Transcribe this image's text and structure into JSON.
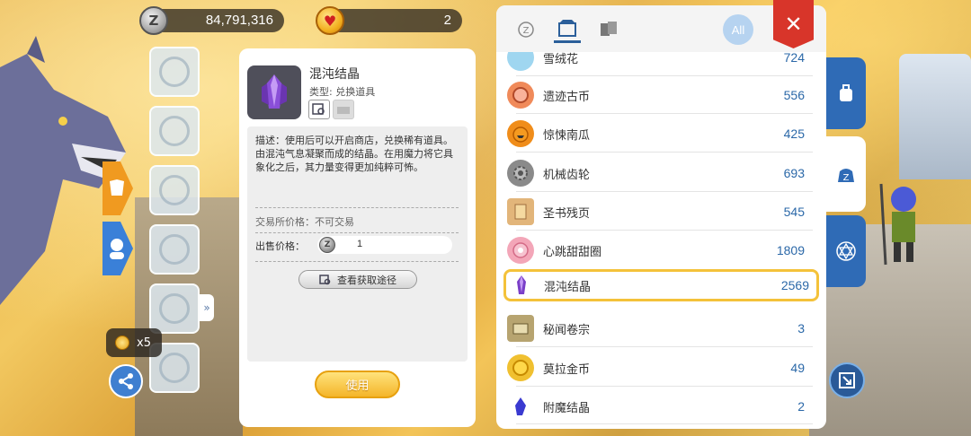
{
  "currency": {
    "zeny_symbol": "Z",
    "zeny_value": "84,791,316",
    "coin_value": "2"
  },
  "stack": {
    "label": "x5"
  },
  "detail": {
    "name": "混沌结晶",
    "type": "类型: 兑换道具",
    "description": "描述：使用后可以开启商店，兑换稀有道具。\n由混沌气息凝聚而成的结晶。在用魔力将它具象化之后，其力量变得更加纯粹可怖。",
    "trade_price": "交易所价格：不可交易",
    "sell_label": "出售价格：",
    "sell_value": "1",
    "source_button": "查看获取途径",
    "use_button": "使用"
  },
  "list": {
    "all_button": "All",
    "partial_top_label": "雪绒花",
    "partial_top_qty": "724",
    "items": [
      {
        "name": "遗迹古币",
        "qty": "556",
        "icon": "ancient-coin-icon",
        "color": "#f08a5a"
      },
      {
        "name": "惊悚南瓜",
        "qty": "425",
        "icon": "pumpkin-icon",
        "color": "#f08d1a"
      },
      {
        "name": "机械齿轮",
        "qty": "693",
        "icon": "gear-icon",
        "color": "#8a8a8a"
      },
      {
        "name": "圣书残页",
        "qty": "545",
        "icon": "page-icon",
        "color": "#e2b57a"
      },
      {
        "name": "心跳甜甜圈",
        "qty": "1809",
        "icon": "donut-icon",
        "color": "#f3a6b8"
      },
      {
        "name": "混沌结晶",
        "qty": "2569",
        "icon": "crystal-icon",
        "color": "#6b3fa6"
      },
      {
        "name": "秘闻卷宗",
        "qty": "3",
        "icon": "scroll-icon",
        "color": "#b7a470"
      },
      {
        "name": "莫拉金币",
        "qty": "49",
        "icon": "gold-coin-icon",
        "color": "#f0c030"
      },
      {
        "name": "附魔结晶",
        "qty": "2",
        "icon": "enchant-crystal-icon",
        "color": "#3a3ad0"
      }
    ],
    "selected_index": 5
  },
  "colors": {
    "accent_blue": "#2f6bb6",
    "qty_blue": "#2b68a8",
    "close_red": "#d8352a",
    "selected_gold": "#f4c23a"
  }
}
